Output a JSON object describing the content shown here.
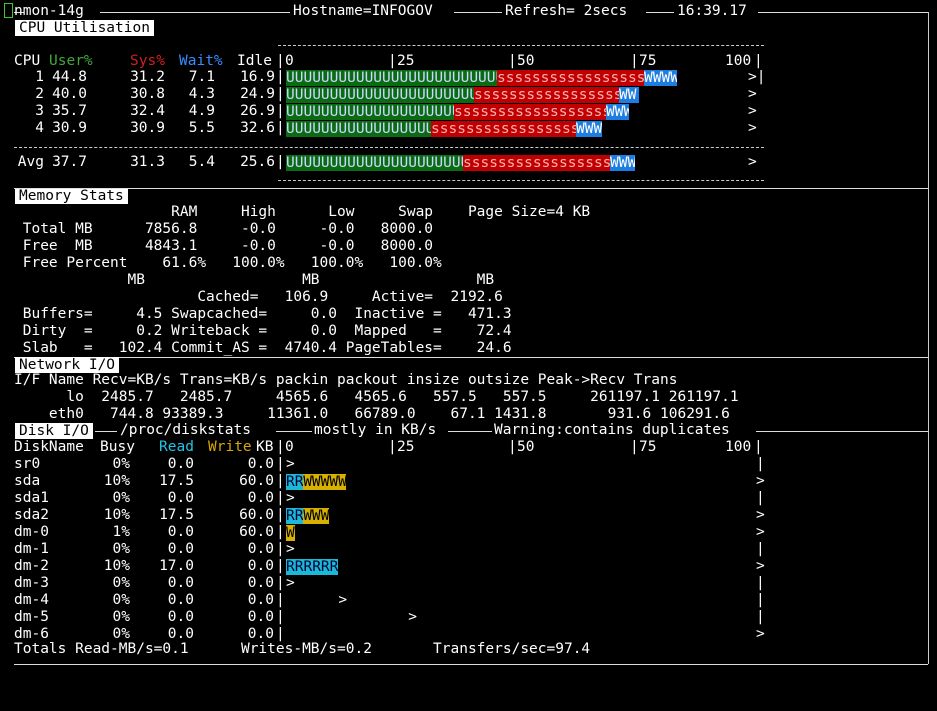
{
  "title_bar": {
    "app": "nmon-14g",
    "hostname": "Hostname=INFOGOV",
    "refresh": "Refresh= 2secs",
    "time": "16:39.17"
  },
  "cpu": {
    "header": "CPU Utilisation",
    "col_cpu": "CPU",
    "col_user": "User%",
    "col_sys": "Sys%",
    "col_wait": "Wait%",
    "col_idle": "Idle",
    "scale": [
      "0",
      "25",
      "50",
      "75",
      "100"
    ],
    "rows": [
      {
        "id": "1",
        "user": "44.8",
        "sys": "31.2",
        "wait": "7.1",
        "idle": "16.9",
        "marker": ">|",
        "bar_user": 0.448,
        "bar_sys": 0.312,
        "bar_wait": 0.071
      },
      {
        "id": "2",
        "user": "40.0",
        "sys": "30.8",
        "wait": "4.3",
        "idle": "24.9",
        "marker": ">",
        "bar_user": 0.4,
        "bar_sys": 0.308,
        "bar_wait": 0.043
      },
      {
        "id": "3",
        "user": "35.7",
        "sys": "32.4",
        "wait": "4.9",
        "idle": "26.9",
        "marker": ">",
        "bar_user": 0.357,
        "bar_sys": 0.324,
        "bar_wait": 0.049
      },
      {
        "id": "4",
        "user": "30.9",
        "sys": "30.9",
        "wait": "5.5",
        "idle": "32.6",
        "marker": ">",
        "bar_user": 0.309,
        "bar_sys": 0.309,
        "bar_wait": 0.055
      }
    ],
    "avg": {
      "id": "Avg",
      "user": "37.7",
      "sys": "31.3",
      "wait": "5.4",
      "idle": "25.6",
      "marker": ">",
      "bar_user": 0.377,
      "bar_sys": 0.313,
      "bar_wait": 0.054
    }
  },
  "memory": {
    "header": "Memory Stats",
    "lines": [
      "                  RAM     High      Low     Swap    Page Size=4 KB",
      " Total MB      7856.8     -0.0     -0.0   8000.0",
      " Free  MB      4843.1     -0.0     -0.0   8000.0",
      " Free Percent    61.6%   100.0%   100.0%   100.0%",
      "             MB                  MB                  MB",
      "                     Cached=   106.9     Active=  2192.6",
      " Buffers=     4.5 Swapcached=     0.0  Inactive =   471.3",
      " Dirty  =     0.2 Writeback =     0.0  Mapped   =    72.4",
      " Slab   =   102.4 Commit_AS =  4740.4 PageTables=    24.6"
    ]
  },
  "network": {
    "header": "Network I/O",
    "lines": [
      "I/F Name Recv=KB/s Trans=KB/s packin packout insize outsize Peak->Recv Trans",
      "      lo  2485.7   2485.7     4565.6   4565.6   557.5   557.5     261197.1 261197.1",
      "    eth0   744.8 93389.3     11361.0   66789.0    67.1 1431.8       931.6 106291.6"
    ]
  },
  "disk": {
    "header": "Disk I/O",
    "title": "/proc/diskstats",
    "mostly": "mostly in KB/s",
    "warning": "Warning:contains duplicates",
    "col_name": "DiskName",
    "col_busy": "Busy",
    "col_read": "Read",
    "col_write": "Write",
    "col_kb": "KB",
    "scale": [
      "0",
      "25",
      "50",
      "75",
      "100"
    ],
    "rows": [
      {
        "name": "sr0",
        "busy": "0%",
        "read": "0.0",
        "write": "0.0",
        "bar": "",
        "r": 0,
        "w": 0,
        "marker": ">",
        "end": "|"
      },
      {
        "name": "sda",
        "busy": "10%",
        "read": "17.5",
        "write": "60.0",
        "bar": "RRWWWWW",
        "r": 2,
        "w": 5,
        "marker": "",
        "end": ">"
      },
      {
        "name": "sda1",
        "busy": "0%",
        "read": "0.0",
        "write": "0.0",
        "bar": "",
        "r": 0,
        "w": 0,
        "marker": ">",
        "end": "|"
      },
      {
        "name": "sda2",
        "busy": "10%",
        "read": "17.5",
        "write": "60.0",
        "bar": "RRWWW",
        "r": 2,
        "w": 3,
        "marker": "",
        "end": ">"
      },
      {
        "name": "dm-0",
        "busy": "1%",
        "read": "0.0",
        "write": "60.0",
        "bar": "W",
        "r": 0,
        "w": 1,
        "marker": "",
        "end": ">"
      },
      {
        "name": "dm-1",
        "busy": "0%",
        "read": "0.0",
        "write": "0.0",
        "bar": "",
        "r": 0,
        "w": 0,
        "marker": ">",
        "end": "|"
      },
      {
        "name": "dm-2",
        "busy": "10%",
        "read": "17.0",
        "write": "0.0",
        "bar": "RRRRRR",
        "r": 6,
        "w": 0,
        "marker": "",
        "end": ">"
      },
      {
        "name": "dm-3",
        "busy": "0%",
        "read": "0.0",
        "write": "0.0",
        "bar": "",
        "r": 0,
        "w": 0,
        "marker": ">",
        "end": "|"
      },
      {
        "name": "dm-4",
        "busy": "0%",
        "read": "0.0",
        "write": "0.0",
        "bar": "",
        "r": 0,
        "w": 0,
        "marker": "      >",
        "end": "|"
      },
      {
        "name": "dm-5",
        "busy": "0%",
        "read": "0.0",
        "write": "0.0",
        "bar": "",
        "r": 0,
        "w": 0,
        "marker": "              >",
        "end": "|"
      },
      {
        "name": "dm-6",
        "busy": "0%",
        "read": "0.0",
        "write": "0.0",
        "bar": "",
        "r": 0,
        "w": 0,
        "marker": "",
        "end": ">"
      }
    ],
    "totals": "Totals Read-MB/s=0.1      Writes-MB/s=0.2       Transfers/sec=97.4"
  }
}
